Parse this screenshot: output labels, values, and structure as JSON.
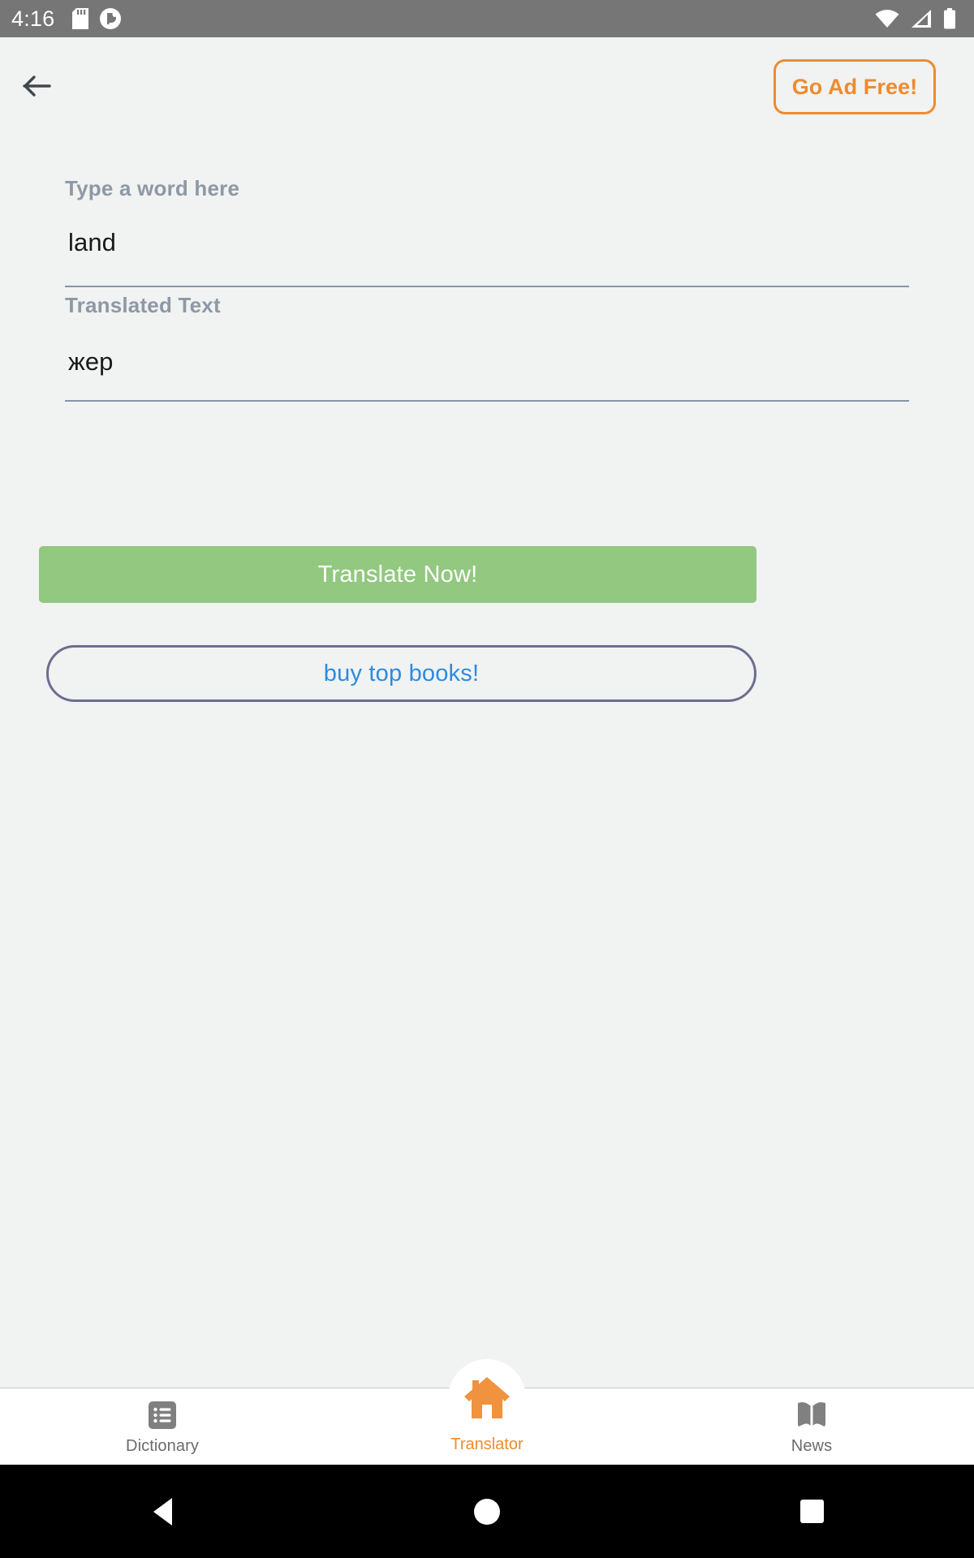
{
  "statusbar": {
    "time": "4:16",
    "left_icons": [
      "sd-card-icon",
      "app-notification-icon"
    ],
    "right_icons": [
      "wifi-icon",
      "cellular-signal-icon",
      "battery-icon"
    ],
    "background": "#767676",
    "foreground": "#ffffff"
  },
  "topbar": {
    "back_icon": "back-arrow-icon",
    "ad_free_label": "Go Ad Free!",
    "accent": "#ee8b2e"
  },
  "form": {
    "source_label": "Type a word here",
    "source_value": "land",
    "source_placeholder": "Type a word here",
    "target_label": "Translated Text",
    "target_value": "жер",
    "target_placeholder": "Translated Text",
    "label_color": "#8d99a5",
    "underline_color": "#8796a8"
  },
  "actions": {
    "translate_label": "Translate Now!",
    "translate_color": "#92c880",
    "books_label": "buy top books!",
    "books_text_color": "#2b8ce0",
    "books_border_color": "#6d6e8d"
  },
  "bottom_nav": {
    "tabs": [
      {
        "label": "Dictionary",
        "icon": "list-icon",
        "active": false
      },
      {
        "label": "Translator",
        "icon": "home-icon",
        "active": true
      },
      {
        "label": "News",
        "icon": "open-book-icon",
        "active": false
      }
    ],
    "active_color": "#ee8b2e",
    "inactive_color": "#6b6b6b"
  },
  "android_nav": {
    "buttons": [
      "back-triangle-icon",
      "home-circle-icon",
      "recents-square-icon"
    ],
    "background": "#000000"
  }
}
